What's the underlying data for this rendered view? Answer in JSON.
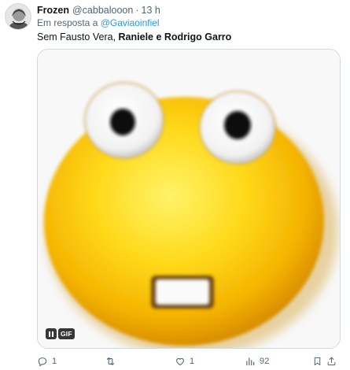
{
  "tweet": {
    "author": {
      "display_name": "Frozen",
      "handle": "@cabbalooon",
      "time": "13 h",
      "separator": "·"
    },
    "reply": {
      "prefix": "Em resposta a",
      "target": "@Gaviaoinfiel"
    },
    "text": {
      "part1": "Sem Fausto Vera, ",
      "part2": "Raniele e Rodrigo Garro"
    },
    "media": {
      "type": "gif",
      "badge": "GIF",
      "image": "grimacing-yellow-emoji"
    },
    "actions": {
      "reply_icon": "reply-icon",
      "reply_count": "1",
      "retweet_icon": "retweet-icon",
      "retweet_count": "",
      "like_icon": "heart-icon",
      "like_count": "1",
      "views_icon": "views-icon",
      "views_count": "92",
      "bookmark_icon": "bookmark-icon",
      "share_icon": "share-icon"
    },
    "colors": {
      "link": "#1d9bf0",
      "secondary_text": "#536471",
      "primary_text": "#0f1419"
    }
  }
}
